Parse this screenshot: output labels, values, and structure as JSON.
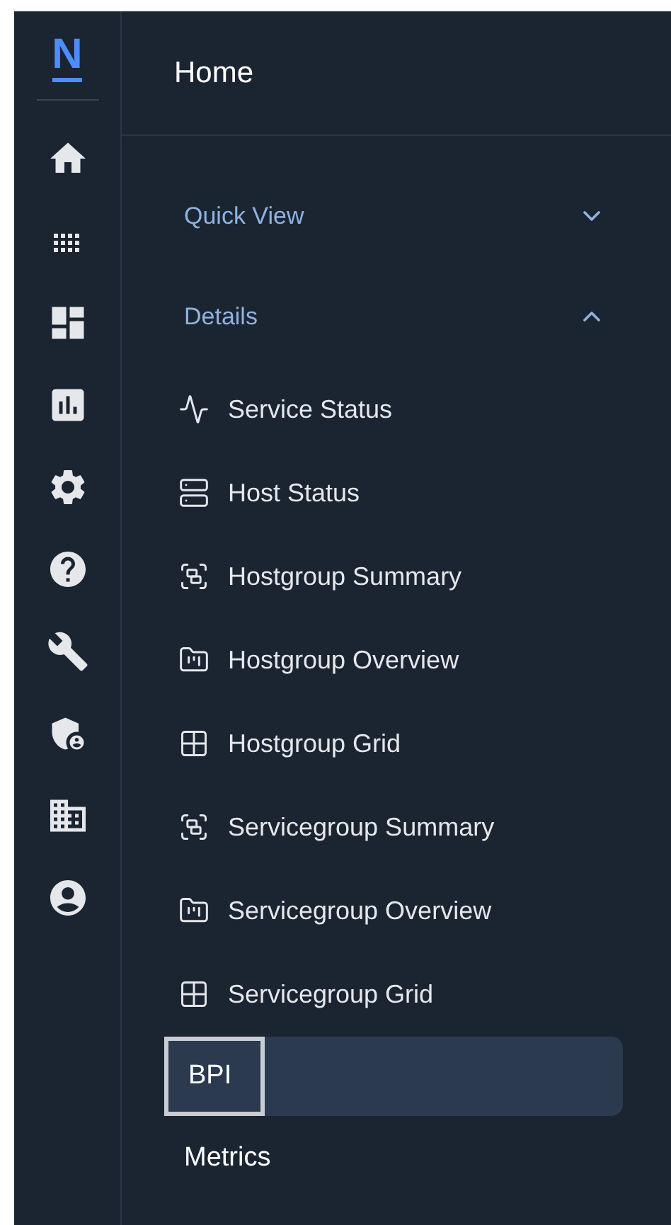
{
  "rail": {
    "logo": "N",
    "items": [
      {
        "kind": "home"
      },
      {
        "kind": "apps"
      },
      {
        "kind": "dashboard"
      },
      {
        "kind": "chart"
      },
      {
        "kind": "settings"
      },
      {
        "kind": "help"
      },
      {
        "kind": "tools"
      },
      {
        "kind": "admin"
      },
      {
        "kind": "building"
      },
      {
        "kind": "account"
      }
    ]
  },
  "header": {
    "title": "Home"
  },
  "menu": [
    {
      "kind": "group",
      "label": "Quick View",
      "expanded": false
    },
    {
      "kind": "group",
      "label": "Details",
      "expanded": true,
      "children": [
        {
          "label": "Service Status",
          "kind": "activity"
        },
        {
          "label": "Host Status",
          "kind": "server"
        },
        {
          "label": "Hostgroup Summary",
          "kind": "group"
        },
        {
          "label": "Hostgroup Overview",
          "kind": "folder"
        },
        {
          "label": "Hostgroup Grid",
          "kind": "grid"
        },
        {
          "label": "Servicegroup Summary",
          "kind": "group"
        },
        {
          "label": "Servicegroup Overview",
          "kind": "folder"
        },
        {
          "label": "Servicegroup Grid",
          "kind": "grid"
        }
      ]
    },
    {
      "kind": "link",
      "label": "BPI",
      "selected": true
    },
    {
      "kind": "link",
      "label": "Metrics",
      "selected": false
    }
  ]
}
